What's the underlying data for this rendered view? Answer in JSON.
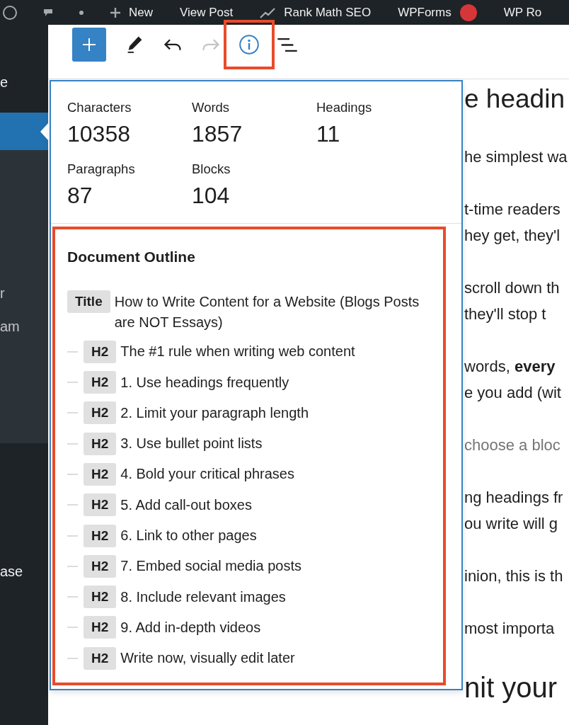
{
  "admin_bar": {
    "items": [
      {
        "kind": "new",
        "label": "New"
      },
      {
        "kind": "link",
        "label": "View Post"
      },
      {
        "kind": "seo",
        "label": "Rank Math SEO"
      },
      {
        "kind": "link",
        "label": "WPForms",
        "notification": true
      },
      {
        "kind": "link",
        "label": "WP Ro"
      }
    ]
  },
  "sidebar": {
    "items": [
      {
        "label": "e",
        "selected": false
      },
      {
        "selected": true,
        "submenu": [
          {
            "label": "r"
          },
          {
            "label": "am"
          }
        ]
      },
      {
        "label": "ase",
        "selected": false
      }
    ]
  },
  "toolbar": {
    "tools": [
      {
        "kind": "add",
        "selected": false,
        "disabled": false,
        "highlighted": false
      },
      {
        "kind": "edit",
        "selected": false,
        "disabled": false,
        "highlighted": false
      },
      {
        "kind": "undo",
        "selected": false,
        "disabled": false,
        "highlighted": false
      },
      {
        "kind": "redo",
        "selected": false,
        "disabled": true,
        "highlighted": false
      },
      {
        "kind": "details",
        "selected": true,
        "disabled": false,
        "highlighted": true
      },
      {
        "kind": "list-view",
        "selected": false,
        "disabled": false,
        "highlighted": false
      }
    ]
  },
  "details_popover": {
    "stats": [
      {
        "label": "Characters",
        "value": "10358"
      },
      {
        "label": "Words",
        "value": "1857"
      },
      {
        "label": "Headings",
        "value": "11"
      },
      {
        "label": "Paragraphs",
        "value": "87"
      },
      {
        "label": "Blocks",
        "value": "104"
      }
    ],
    "outline": {
      "title": "Document Outline",
      "highlighted": true,
      "items": [
        {
          "badge": "Title",
          "text": "How to Write Content for a Website (Blogs Posts are NOT Essays)",
          "children": [
            {
              "badge": "H2",
              "text": "The #1 rule when writing web content"
            },
            {
              "badge": "H2",
              "text": "1. Use headings frequently"
            },
            {
              "badge": "H2",
              "text": "2. Limit your paragraph length"
            },
            {
              "badge": "H2",
              "text": "3. Use bullet point lists"
            },
            {
              "badge": "H2",
              "text": "4. Bold your critical phrases"
            },
            {
              "badge": "H2",
              "text": "5. Add call-out boxes"
            },
            {
              "badge": "H2",
              "text": "6. Link to other pages"
            },
            {
              "badge": "H2",
              "text": "7. Embed social media posts"
            },
            {
              "badge": "H2",
              "text": "8. Include relevant images"
            },
            {
              "badge": "H2",
              "text": "9. Add in-depth videos"
            },
            {
              "badge": "H2",
              "text": "Write now, visually edit later"
            }
          ]
        }
      ]
    }
  },
  "editor": {
    "blocks": [
      {
        "kind": "heading",
        "text": "e headin"
      },
      {
        "kind": "paragraph",
        "lines": [
          "he simplest wa"
        ]
      },
      {
        "kind": "paragraph",
        "lines": [
          "t-time readers",
          "hey get, they'l"
        ]
      },
      {
        "kind": "paragraph",
        "lines": [
          "scroll down th",
          "they'll stop t"
        ]
      },
      {
        "kind": "paragraph",
        "lines": [
          "words, **every**",
          "e you add (wit"
        ]
      },
      {
        "kind": "placeholder",
        "lines": [
          "choose a bloc"
        ]
      },
      {
        "kind": "paragraph",
        "lines": [
          "ng headings fr",
          "ou write will g"
        ]
      },
      {
        "kind": "paragraph",
        "lines": [
          "inion, this is th"
        ]
      },
      {
        "kind": "paragraph",
        "lines": [
          "most importa"
        ]
      },
      {
        "kind": "heading",
        "text": "nit your"
      }
    ]
  }
}
